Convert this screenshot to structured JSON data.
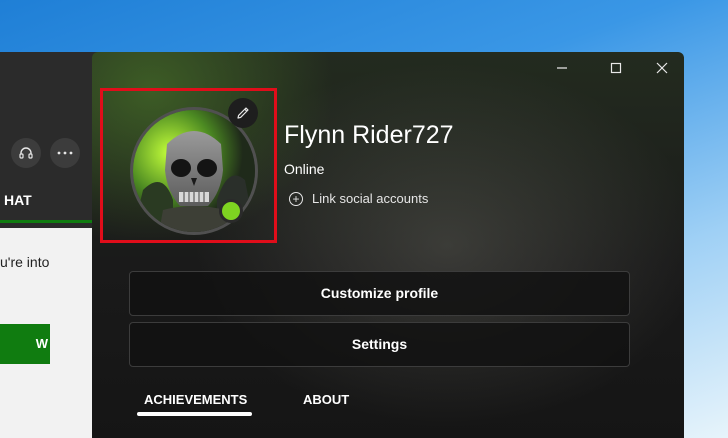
{
  "background_app": {
    "chat_tab_partial": "HAT",
    "panel_text_partial": "u're into",
    "button_partial": "W",
    "icons": [
      "headset-icon",
      "more-icon"
    ]
  },
  "window": {
    "controls": [
      "minimize",
      "maximize",
      "close"
    ]
  },
  "profile": {
    "gamertag": "Flynn Rider727",
    "status": "Online",
    "link_social": "Link social accounts",
    "status_color": "#7ed321"
  },
  "buttons": {
    "customize": "Customize profile",
    "settings": "Settings"
  },
  "tabs": {
    "achievements": "ACHIEVEMENTS",
    "about": "ABOUT"
  },
  "colors": {
    "accent_green": "#107c10",
    "highlight_red": "#e00d1a"
  }
}
